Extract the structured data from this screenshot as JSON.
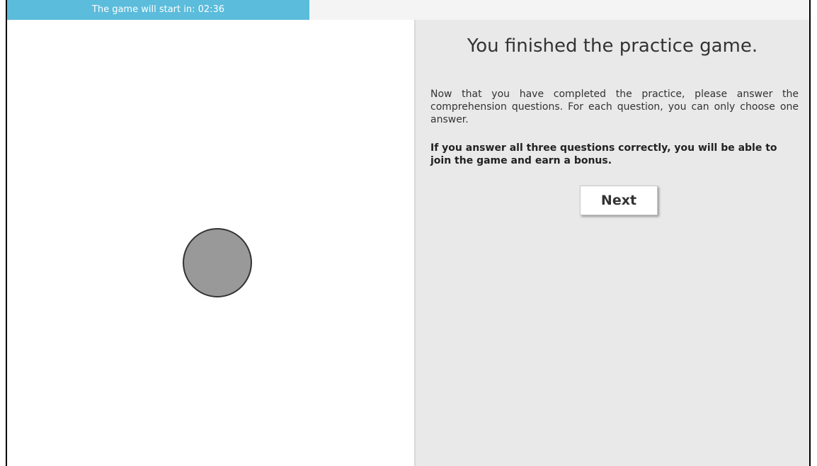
{
  "timer": {
    "label": "The game will start in: 02:36"
  },
  "practice_complete": {
    "title": "You finished the practice game.",
    "instructions": "Now that you have completed the practice, please answer the comprehension questions. For each question, you can only choose one answer.",
    "bonus_note": "If you answer all three questions correctly, you will be able to join the game and earn a bonus.",
    "next_label": "Next"
  },
  "colors": {
    "timer_bar": "#5bbcdc",
    "panel_background": "#e9e9e9",
    "player_fill": "#999999",
    "player_stroke": "#333333"
  },
  "icons": {
    "player": "grey-circle"
  }
}
